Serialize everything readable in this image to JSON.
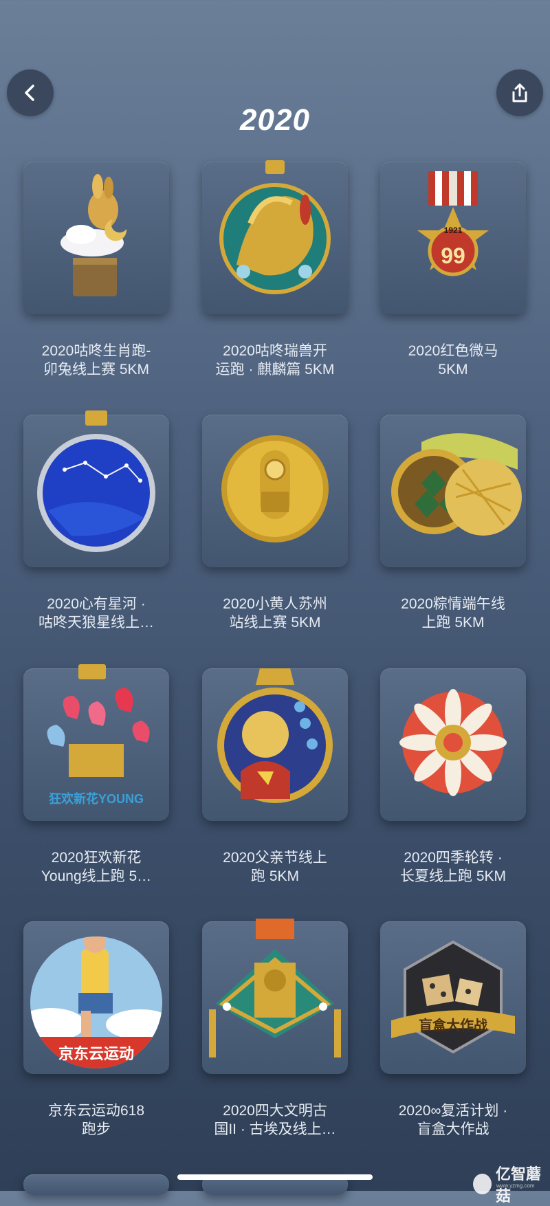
{
  "header": {
    "back_icon": "chevron-left-icon",
    "share_icon": "share-icon",
    "year_title": "2020"
  },
  "medals": [
    {
      "label_line1": "2020咕咚生肖跑-",
      "label_line2": "卯兔线上赛 5KM",
      "icon": "rabbit-medal"
    },
    {
      "label_line1": "2020咕咚瑞兽开",
      "label_line2": "运跑 · 麒麟篇 5KM",
      "icon": "qilin-medal"
    },
    {
      "label_line1": "2020红色微马",
      "label_line2": "5KM",
      "icon": "red-star-medal"
    },
    {
      "label_line1": "2020心有星河 ·",
      "label_line2": "咕咚天狼星线上…",
      "icon": "star-river-medal"
    },
    {
      "label_line1": "2020小黄人苏州",
      "label_line2": "站线上赛 5KM",
      "icon": "minion-medal"
    },
    {
      "label_line1": "2020粽情端午线",
      "label_line2": "上跑 5KM",
      "icon": "zongzi-medal"
    },
    {
      "label_line1": "2020狂欢新花",
      "label_line2": "Young线上跑 5…",
      "icon": "balloon-medal"
    },
    {
      "label_line1": "2020父亲节线上",
      "label_line2": "跑 5KM",
      "icon": "superman-medal"
    },
    {
      "label_line1": "2020四季轮转 ·",
      "label_line2": "长夏线上跑 5KM",
      "icon": "mandala-medal"
    },
    {
      "label_line1": "京东云运动618",
      "label_line2": "跑步",
      "icon": "runner-medal"
    },
    {
      "label_line1": "2020四大文明古",
      "label_line2": "国II · 古埃及线上…",
      "icon": "egypt-medal"
    },
    {
      "label_line1": "2020∞复活计划 ·",
      "label_line2": "盲盒大作战",
      "icon": "dice-medal"
    }
  ],
  "medal_texts": {
    "red_star_year": "1921",
    "red_star_number": "99",
    "balloon_text": "狂欢新花YOUNG",
    "runner_banner": "京东云运动",
    "dice_banner": "盲盒大作战"
  },
  "watermark": {
    "text": "亿智蘑菇",
    "url": "www.yzmg.com"
  },
  "colors": {
    "background_top": "#6b7f99",
    "background_bottom": "#2f3f57",
    "card": "#4d6079",
    "gold": "#d4a93a"
  }
}
